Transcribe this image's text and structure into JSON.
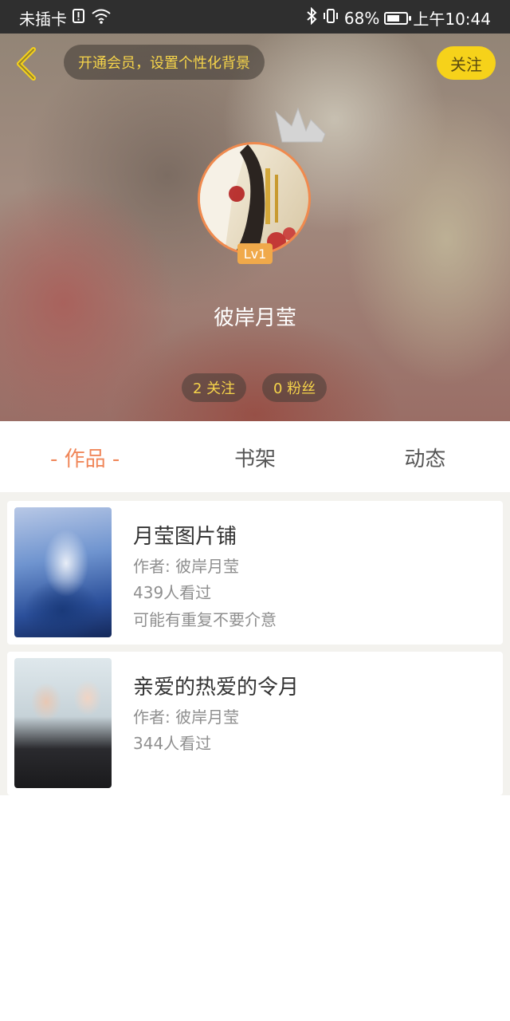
{
  "status_bar": {
    "carrier": "未插卡",
    "battery": "68%",
    "time": "上午10:44",
    "battery_level": 0.68
  },
  "header": {
    "vip_banner": "开通会员，设置个性化背景",
    "follow_label": "关注"
  },
  "profile": {
    "level": "Lv1",
    "username": "彼岸月莹",
    "following": "2 关注",
    "fans": "0 粉丝"
  },
  "tabs": [
    {
      "label": "作品",
      "active": true
    },
    {
      "label": "书架",
      "active": false
    },
    {
      "label": "动态",
      "active": false
    }
  ],
  "works": [
    {
      "title": "月莹图片铺",
      "author": "作者: 彼岸月莹",
      "views": "439人看过",
      "desc": "可能有重复不要介意"
    },
    {
      "title": "亲爱的热爱的令月",
      "author": "作者: 彼岸月莹",
      "views": "344人看过",
      "desc": ""
    }
  ],
  "colors": {
    "accent": "#f0875a",
    "follow_bg": "#f6d21a",
    "badge": "#f0a94a"
  },
  "icons": [
    "back-arrow-icon",
    "crown-icon",
    "bluetooth-icon",
    "vibrate-icon",
    "wifi-icon",
    "sim-alert-icon",
    "battery-icon"
  ]
}
